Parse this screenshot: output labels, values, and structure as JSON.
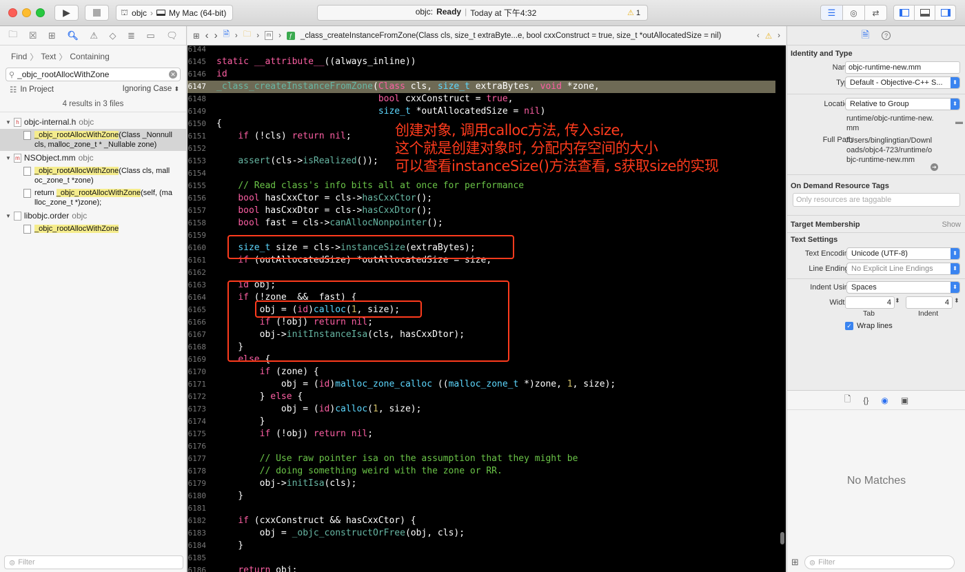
{
  "toolbar": {
    "scheme_target": "objc",
    "scheme_device": "My Mac (64-bit)",
    "activity_project": "objc:",
    "activity_status": "Ready",
    "activity_separator": "|",
    "activity_time": "Today at 下午4:32",
    "warning_count": "1"
  },
  "navigator": {
    "find": "Find",
    "find_sep1": "〉",
    "text": "Text",
    "find_sep2": "〉",
    "containing": "Containing",
    "search_value": "_objc_rootAllocWithZone",
    "scope": "In Project",
    "case": "Ignoring Case",
    "results_summary": "4 results in 3 files",
    "files": [
      {
        "name": "objc-internal.h",
        "target": "objc",
        "letter": "h",
        "matches": [
          {
            "pre": "",
            "hit": "_objc_rootAllocWithZone",
            "post": "(Class _Nonnull",
            "line2": "cls, malloc_zone_t * _Nullable zone)"
          }
        ]
      },
      {
        "name": "NSObject.mm",
        "target": "objc",
        "letter": "m",
        "matches": [
          {
            "pre": "",
            "hit": "_objc_rootAllocWithZone",
            "post": "(Class cls, mall",
            "line2": "oc_zone_t *zone)"
          },
          {
            "pre": "return ",
            "hit": "_objc_rootAllocWithZone",
            "post": "(self, (ma",
            "line2": "lloc_zone_t *)zone);"
          }
        ]
      },
      {
        "name": "libobjc.order",
        "target": "objc",
        "letter": "",
        "matches": [
          {
            "pre": "",
            "hit": "_objc_rootAllocWithZone",
            "post": "",
            "line2": ""
          }
        ]
      }
    ],
    "filter_placeholder": "Filter"
  },
  "jumpbar": {
    "function_sig": "_class_createInstanceFromZone(Class cls, size_t extraByte...e, bool cxxConstruct = true, size_t *outAllocatedSize = nil)",
    "m_icon": "m"
  },
  "code": {
    "current_line": 6147,
    "lines": [
      {
        "n": "6144",
        "h": ""
      },
      {
        "n": "6145",
        "h": "<span class='kw'>static</span> <span class='kw'>__attribute__</span>((always_inline))"
      },
      {
        "n": "6146",
        "h": "<span class='kw'>id</span>"
      },
      {
        "n": "6147",
        "h": "<span class='fn'>_class_createInstanceFromZone</span>(<span class='kw'>Class</span> cls, <span class='ty'>size_t</span> extraBytes, <span class='kw'>void</span> *zone,"
      },
      {
        "n": "6148",
        "h": "                              <span class='kw'>bool</span> cxxConstruct = <span class='kw'>true</span>,"
      },
      {
        "n": "6149",
        "h": "                              <span class='ty'>size_t</span> *outAllocatedSize = <span class='kw'>nil</span>)"
      },
      {
        "n": "6150",
        "h": "{"
      },
      {
        "n": "6151",
        "h": "    <span class='kw'>if</span> (!cls) <span class='kw'>return</span> <span class='kw'>nil</span>;"
      },
      {
        "n": "6152",
        "h": ""
      },
      {
        "n": "6153",
        "h": "    <span class='fn'>assert</span>(cls-><span class='fn'>isRealized</span>());"
      },
      {
        "n": "6154",
        "h": ""
      },
      {
        "n": "6155",
        "h": "    <span class='cm'>// Read class's info bits all at once for performance</span>"
      },
      {
        "n": "6156",
        "h": "    <span class='kw'>bool</span> hasCxxCtor = cls-><span class='fn'>hasCxxCtor</span>();"
      },
      {
        "n": "6157",
        "h": "    <span class='kw'>bool</span> hasCxxDtor = cls-><span class='fn'>hasCxxDtor</span>();"
      },
      {
        "n": "6158",
        "h": "    <span class='kw'>bool</span> fast = cls-><span class='fn'>canAllocNonpointer</span>();"
      },
      {
        "n": "6159",
        "h": ""
      },
      {
        "n": "6160",
        "h": "    <span class='ty'>size_t</span> size = cls-><span class='fn'>instanceSize</span>(extraBytes);"
      },
      {
        "n": "6161",
        "h": "    <span class='kw'>if</span> (outAllocatedSize) *outAllocatedSize = size;"
      },
      {
        "n": "6162",
        "h": ""
      },
      {
        "n": "6163",
        "h": "    <span class='kw'>id</span> obj;"
      },
      {
        "n": "6164",
        "h": "    <span class='kw'>if</span> (!zone  &&  fast) {"
      },
      {
        "n": "6165",
        "h": "        obj = (<span class='kw'>id</span>)<span class='ty'>calloc</span>(<span class='nm'>1</span>, size);"
      },
      {
        "n": "6166",
        "h": "        <span class='kw'>if</span> (!obj) <span class='kw'>return</span> <span class='kw'>nil</span>;"
      },
      {
        "n": "6167",
        "h": "        obj-><span class='fn'>initInstanceIsa</span>(cls, hasCxxDtor);"
      },
      {
        "n": "6168",
        "h": "    }"
      },
      {
        "n": "6169",
        "h": "    <span class='kw'>else</span> {"
      },
      {
        "n": "6170",
        "h": "        <span class='kw'>if</span> (zone) {"
      },
      {
        "n": "6171",
        "h": "            obj = (<span class='kw'>id</span>)<span class='ty'>malloc_zone_calloc</span> ((<span class='ty'>malloc_zone_t</span> *)zone, <span class='nm'>1</span>, size);"
      },
      {
        "n": "6172",
        "h": "        } <span class='kw'>else</span> {"
      },
      {
        "n": "6173",
        "h": "            obj = (<span class='kw'>id</span>)<span class='ty'>calloc</span>(<span class='nm'>1</span>, size);"
      },
      {
        "n": "6174",
        "h": "        }"
      },
      {
        "n": "6175",
        "h": "        <span class='kw'>if</span> (!obj) <span class='kw'>return</span> <span class='kw'>nil</span>;"
      },
      {
        "n": "6176",
        "h": ""
      },
      {
        "n": "6177",
        "h": "        <span class='cm'>// Use raw pointer isa on the assumption that they might be</span>"
      },
      {
        "n": "6178",
        "h": "        <span class='cm'>// doing something weird with the zone or RR.</span>"
      },
      {
        "n": "6179",
        "h": "        obj-><span class='fn'>initIsa</span>(cls);"
      },
      {
        "n": "6180",
        "h": "    }"
      },
      {
        "n": "6181",
        "h": ""
      },
      {
        "n": "6182",
        "h": "    <span class='kw'>if</span> (cxxConstruct && hasCxxCtor) {"
      },
      {
        "n": "6183",
        "h": "        obj = <span class='fn'>_objc_constructOrFree</span>(obj, cls);"
      },
      {
        "n": "6184",
        "h": "    }"
      },
      {
        "n": "6185",
        "h": ""
      },
      {
        "n": "6186",
        "h": "    <span class='kw'>return</span> obj;"
      }
    ]
  },
  "annotation": {
    "line1": "创建对象, 调用calloc方法, 传入size,",
    "line2": "这个就是创建对象时, 分配内存空间的大小",
    "line3": "可以查看instanceSize()方法查看, s获取size的实现"
  },
  "inspector": {
    "identity_title": "Identity and Type",
    "name_label": "Name",
    "name_value": "objc-runtime-new.mm",
    "type_label": "Type",
    "type_value": "Default - Objective-C++ S...",
    "location_label": "Location",
    "location_value": "Relative to Group",
    "location_path": "runtime/objc-runtime-new.mm",
    "fullpath_label": "Full Path",
    "fullpath_value": "/Users/binglingtian/Downloads/objc4-723/runtime/objc-runtime-new.mm",
    "ondemand_title": "On Demand Resource Tags",
    "ondemand_placeholder": "Only resources are taggable",
    "target_title": "Target Membership",
    "target_show": "Show",
    "text_title": "Text Settings",
    "encoding_label": "Text Encoding",
    "encoding_value": "Unicode (UTF-8)",
    "endings_label": "Line Endings",
    "endings_value": "No Explicit Line Endings",
    "indent_label": "Indent Using",
    "indent_value": "Spaces",
    "widths_label": "Widths",
    "tab_value": "4",
    "indent_width_value": "4",
    "tab_caption": "Tab",
    "indent_caption": "Indent",
    "wrap_label": "Wrap lines",
    "no_matches": "No Matches",
    "filter_placeholder": "Filter"
  }
}
